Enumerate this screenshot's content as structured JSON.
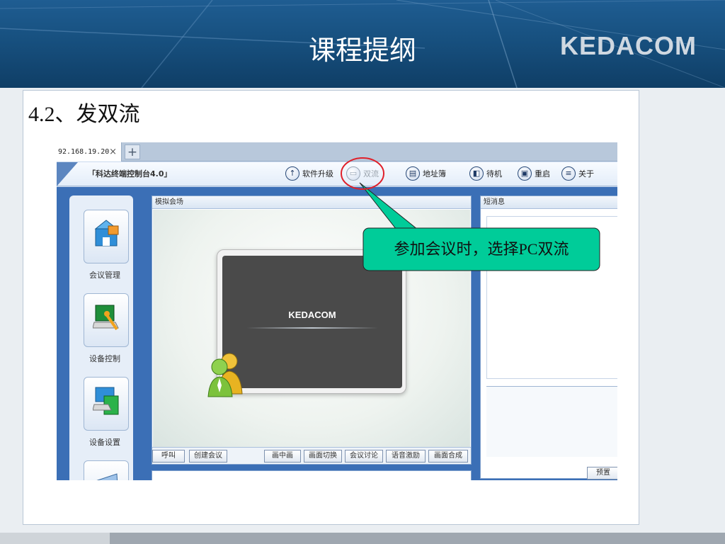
{
  "slide": {
    "title": "课程提纲",
    "brand": "KEDACOM",
    "section_heading": "4.2、发双流"
  },
  "browser": {
    "tab_label": "92.168.19.20",
    "tab_close": "×",
    "new_tab": "+"
  },
  "app": {
    "title": "「科达终端控制台4.0」",
    "toolbar": [
      {
        "label": "软件升级",
        "icon": "↑"
      },
      {
        "label": "双流",
        "icon": "▭"
      },
      {
        "label": "地址簿",
        "icon": "▤"
      },
      {
        "label": "待机",
        "icon": "◧"
      },
      {
        "label": "重启",
        "icon": "▣"
      },
      {
        "label": "关于",
        "icon": "≡"
      }
    ],
    "nav": [
      {
        "label": "会议管理"
      },
      {
        "label": "设备控制"
      },
      {
        "label": "设备设置"
      }
    ],
    "venue_panel_title": "模拟会场",
    "monitor_logo": "KEDACOM",
    "message_panel_title": "短消息",
    "preset_button": "预置",
    "controls": [
      "呼叫",
      "创建会议",
      "画中画",
      "画面切换",
      "会议讨论",
      "语音激励",
      "画面合成"
    ]
  },
  "callout": {
    "text": "参加会议时，选择PC双流",
    "fill": "#00cc99",
    "highlight": "#e0202a"
  }
}
